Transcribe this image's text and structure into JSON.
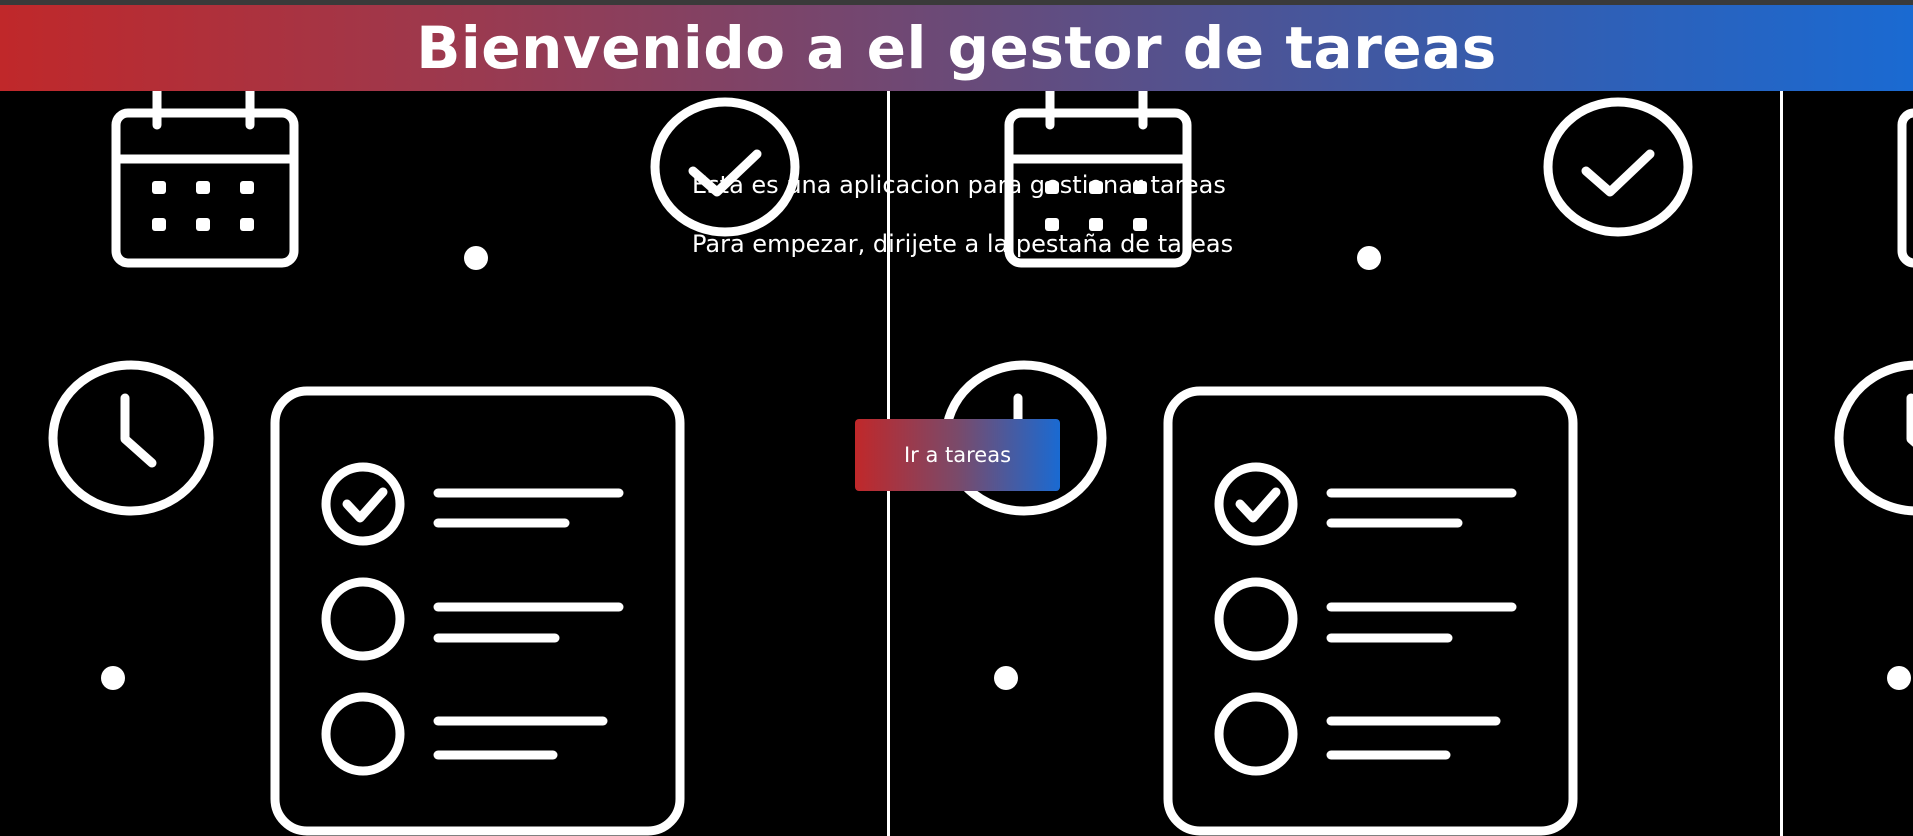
{
  "header": {
    "title": "Bienvenido a el gestor de tareas"
  },
  "intro": {
    "line1": "Esta es una aplicacion para gestionar tareas",
    "line2": "Para empezar, dirijete a la pestaña de tareas"
  },
  "actions": {
    "go_tasks_label": "Ir a tareas"
  },
  "background": {
    "pattern_icons": [
      "calendar-icon",
      "check-circle-icon",
      "clock-icon",
      "checklist-icon"
    ]
  },
  "colors": {
    "gradient_start": "#c0282a",
    "gradient_end": "#1a6ad2",
    "background": "#000000",
    "foreground": "#ffffff"
  }
}
